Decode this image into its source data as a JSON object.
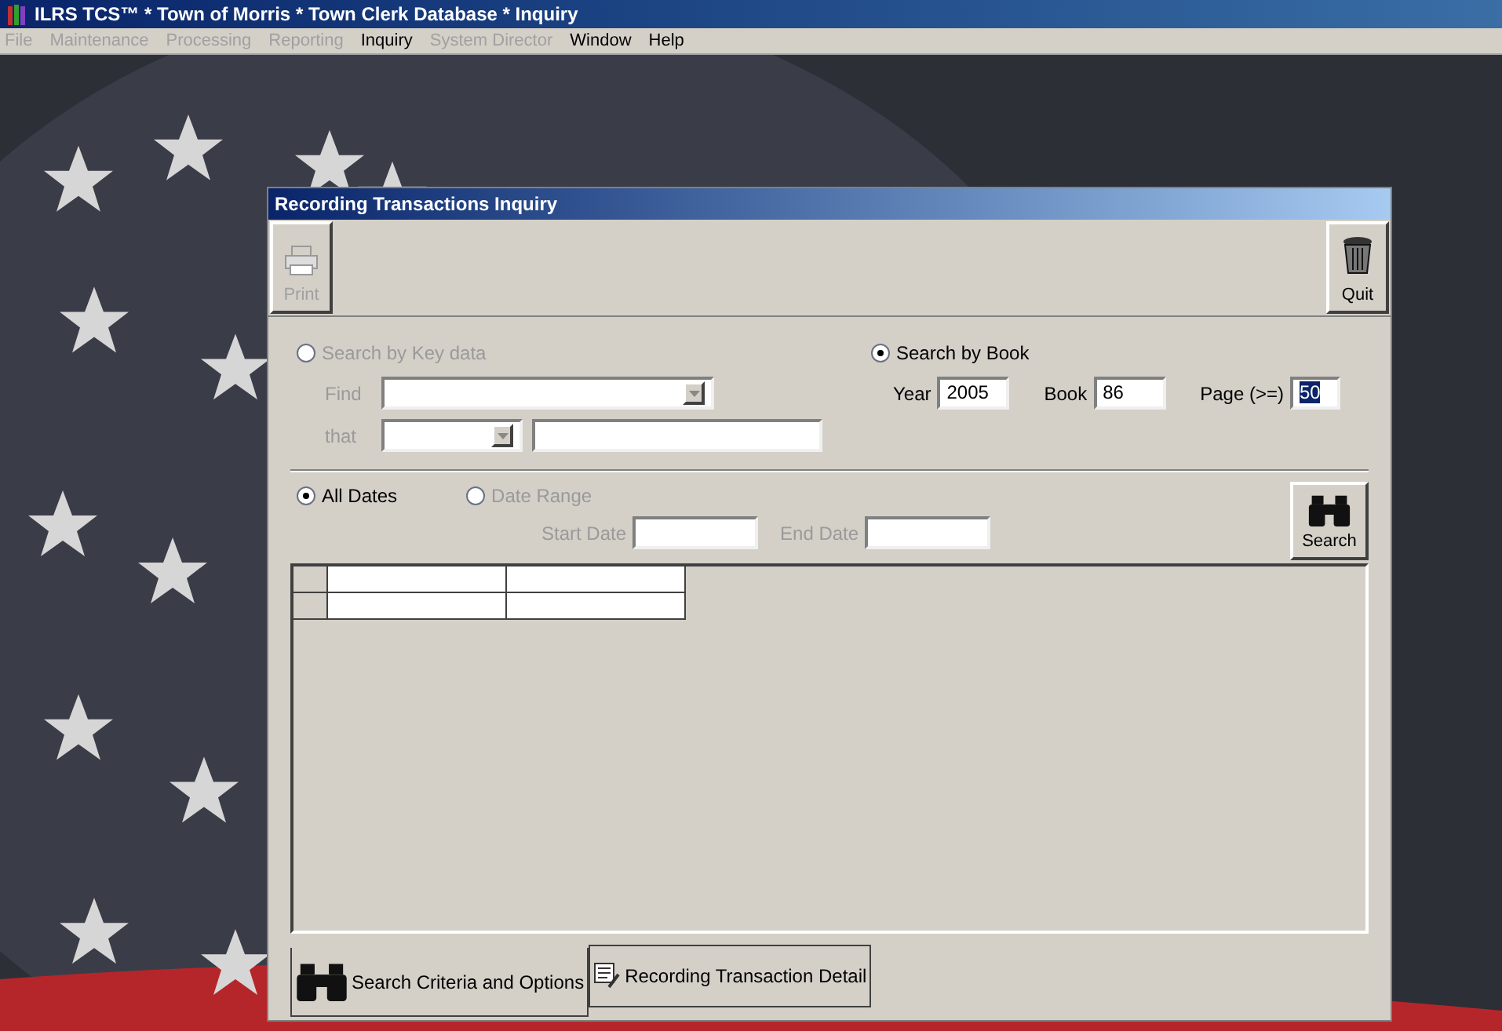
{
  "window": {
    "title": "ILRS TCS™ * Town of Morris * Town Clerk Database * Inquiry"
  },
  "menu": [
    {
      "label": "File",
      "disabled": true
    },
    {
      "label": "Maintenance",
      "disabled": true
    },
    {
      "label": "Processing",
      "disabled": true
    },
    {
      "label": "Reporting",
      "disabled": true
    },
    {
      "label": "Inquiry",
      "disabled": false
    },
    {
      "label": "System Director",
      "disabled": true
    },
    {
      "label": "Window",
      "disabled": false
    },
    {
      "label": "Help",
      "disabled": false
    }
  ],
  "dialog": {
    "title": "Recording Transactions Inquiry",
    "toolbar": [
      {
        "label": "Print",
        "disabled": true
      },
      {
        "label": "Quit",
        "disabled": false
      }
    ],
    "search_mode": [
      {
        "label": "Search by Key data",
        "selected": false,
        "disabled": true
      },
      {
        "label": "Search by Book",
        "selected": true,
        "disabled": false
      }
    ],
    "key_fields": {
      "find_label": "Find",
      "that_label": "that"
    },
    "book_fields": [
      {
        "label": "Year",
        "value": "2005"
      },
      {
        "label": "Book",
        "value": "86"
      },
      {
        "label": "Page (>=)",
        "value": "50"
      }
    ],
    "date_mode": [
      {
        "label": "All Dates",
        "selected": true,
        "disabled": false
      },
      {
        "label": "Date Range",
        "selected": false,
        "disabled": true
      }
    ],
    "date_fields": [
      {
        "label": "Start Date"
      },
      {
        "label": "End Date"
      }
    ],
    "search_button": "Search",
    "tabs": [
      {
        "label": "Search Criteria and Options",
        "selected": true
      },
      {
        "label": "Recording Transaction Detail",
        "selected": false
      }
    ]
  }
}
